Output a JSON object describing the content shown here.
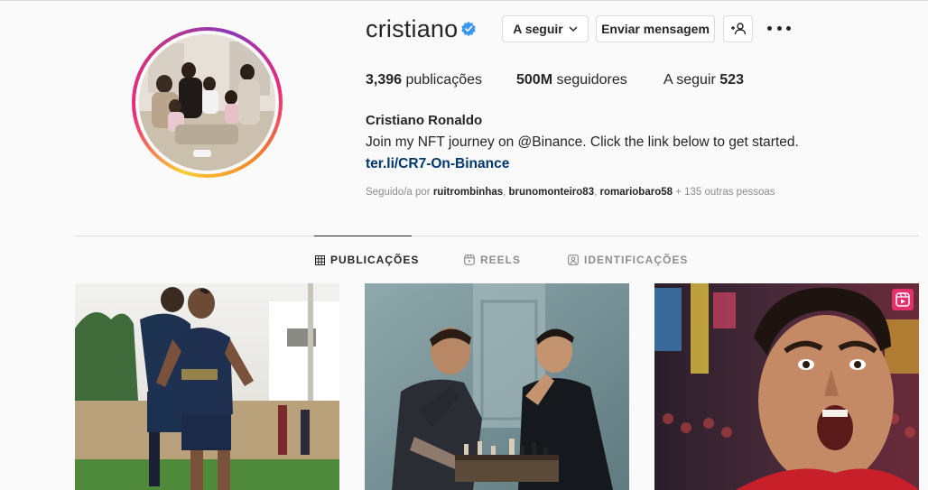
{
  "profile": {
    "username": "cristiano",
    "verified": true,
    "full_name": "Cristiano Ronaldo",
    "bio": "Join my NFT journey on @Binance. Click the link below to get started.",
    "link": "ter.li/CR7-On-Binance"
  },
  "actions": {
    "follow_label": "A seguir",
    "message_label": "Enviar mensagem",
    "suggest_icon": "add-person-icon",
    "more_icon": "more-options-icon"
  },
  "stats": {
    "posts_count": "3,396",
    "posts_label": "publicações",
    "followers_count": "500M",
    "followers_label": "seguidores",
    "following_label": "A seguir",
    "following_count": "523"
  },
  "followed_by": {
    "prefix": "Seguido/a por",
    "users": [
      "ruitrombinhas",
      "brunomonteiro83",
      "romariobaro58"
    ],
    "suffix": "+ 135 outras pessoas"
  },
  "tabs": [
    {
      "label": "PUBLICAÇÕES",
      "icon": "grid-icon",
      "active": true
    },
    {
      "label": "REELS",
      "icon": "reels-icon",
      "active": false
    },
    {
      "label": "IDENTIFICAÇÕES",
      "icon": "tagged-icon",
      "active": false
    }
  ],
  "posts": [
    {
      "type": "photo",
      "subject": "football-training"
    },
    {
      "type": "photo",
      "subject": "chess"
    },
    {
      "type": "reel",
      "subject": "celebration"
    }
  ],
  "colors": {
    "accent_link": "#00376b",
    "verified_blue": "#3897f0",
    "reel_badge": "#e1306c"
  }
}
